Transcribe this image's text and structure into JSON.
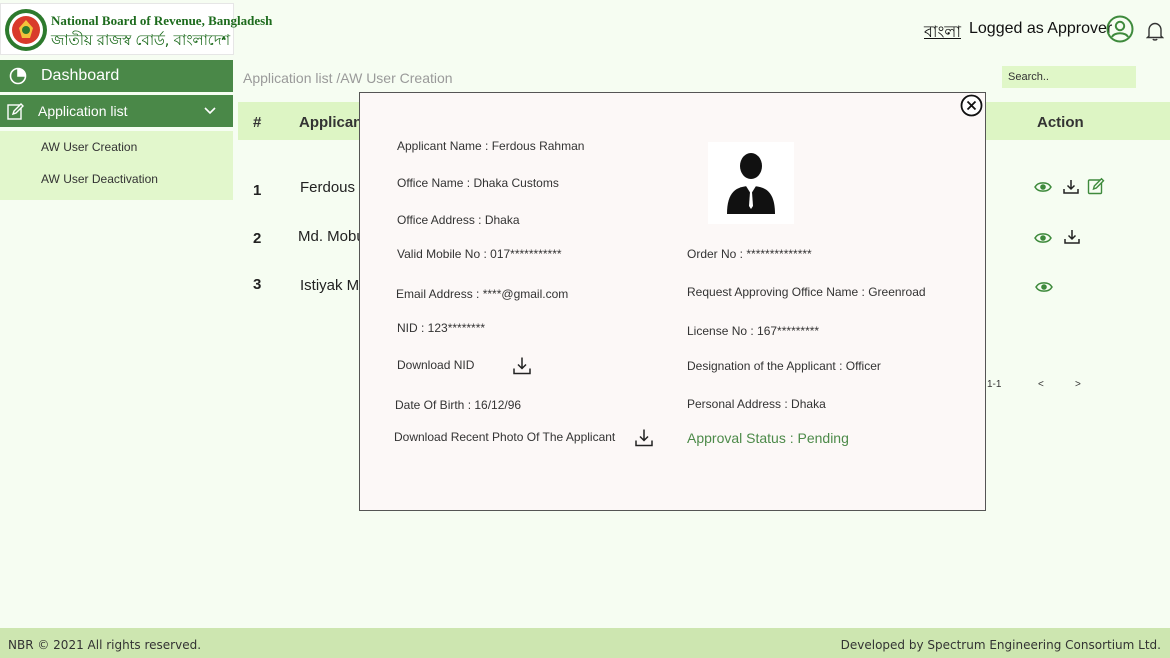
{
  "header": {
    "org_name_en": "National Board of Revenue, Bangladesh",
    "org_name_bn": "জাতীয় রাজস্ব বোর্ড, বাংলাদেশ",
    "language_toggle": "বাংলা",
    "logged_as": "Logged as Approver",
    "user_icon": "user-circle-icon",
    "bell_icon": "bell-icon"
  },
  "sidebar": {
    "dashboard_label": "Dashboard",
    "application_list_label": "Application list",
    "sub_items": [
      "AW User Creation",
      "AW User Deactivation"
    ]
  },
  "main": {
    "breadcrumb": "Application list /AW User Creation",
    "search_placeholder": "Search..",
    "table": {
      "headers": {
        "num": "#",
        "applicant": "Applicant",
        "action": "Action"
      },
      "rows": [
        {
          "num": "1",
          "name": "Ferdous R",
          "actions": [
            "view",
            "download",
            "edit"
          ]
        },
        {
          "num": "2",
          "name": "Md. Mobu",
          "actions": [
            "view",
            "download"
          ]
        },
        {
          "num": "3",
          "name": "Istiyak M",
          "actions": [
            "view"
          ]
        }
      ]
    },
    "pagination": {
      "range": "1-1",
      "prev": "<",
      "next": ">"
    }
  },
  "modal": {
    "applicant_name": "Applicant Name :  Ferdous Rahman",
    "office_name": "Office Name : Dhaka Customs",
    "office_address": "Office Address :  Dhaka",
    "mobile": "Valid Mobile No : 017***********",
    "email": "Email Address : ****@gmail.com",
    "nid": "NID  :  123********",
    "download_nid": "Download NID",
    "dob": "Date Of Birth : 16/12/96",
    "download_photo": "Download Recent Photo Of The Applicant",
    "order_no": "Order No  : **************",
    "approving_office": "Request Approving Office Name  :   Greenroad",
    "license_no": "License No  : 167*********",
    "designation": "Designation of the Applicant  :  Officer",
    "personal_address": "Personal Address : Dhaka",
    "approval_status": "Approval Status  :  Pending"
  },
  "footer": {
    "left": "NBR © 2021 All rights reserved.",
    "right": "Developed by Spectrum Engineering Consortium Ltd."
  },
  "colors": {
    "sidebar_active": "#4a8848",
    "sidebar_sub_bg": "#e2f7cc",
    "table_header_bg": "#ddf5c4",
    "footer_bg": "#cde6b0",
    "status_green": "#4c8a49"
  }
}
